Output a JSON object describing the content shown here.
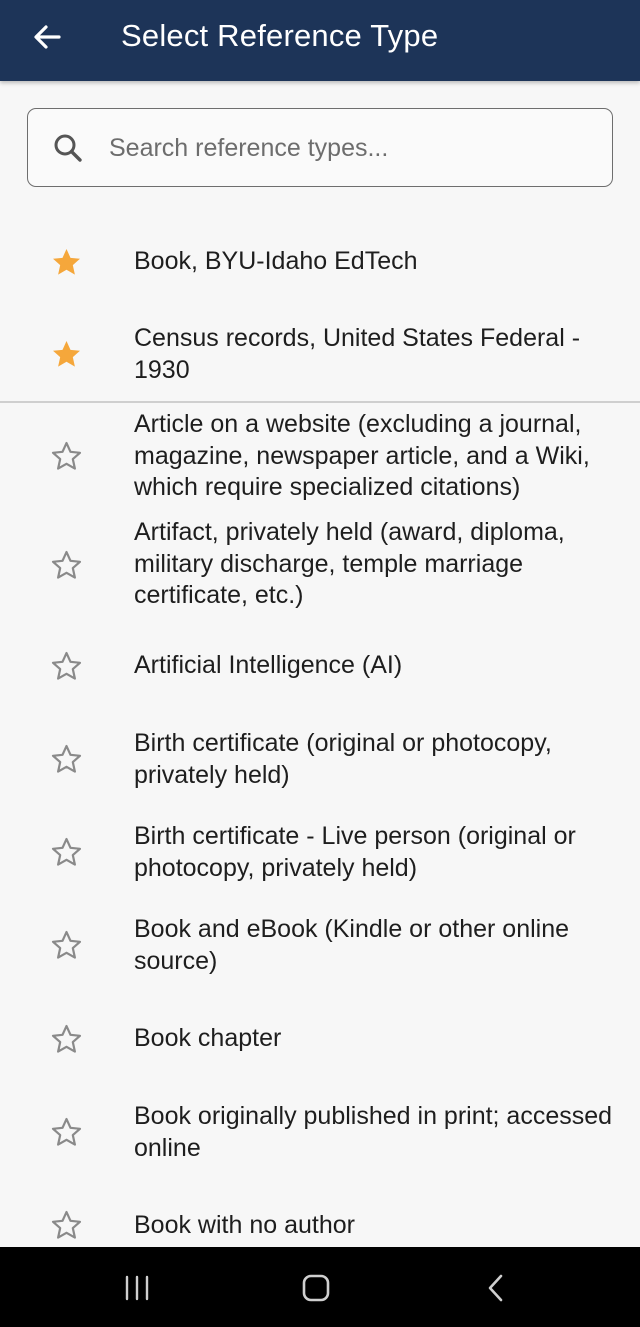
{
  "app_bar": {
    "title": "Select Reference Type",
    "back_icon": "arrow-left-icon"
  },
  "search": {
    "placeholder": "Search reference types...",
    "value": "",
    "icon": "search-icon"
  },
  "colors": {
    "app_bar": "#1d3458",
    "star_filled": "#f5a73b",
    "star_outline": "#8a8a8a",
    "background": "#f7f7f7"
  },
  "favorites": [
    {
      "label": "Book, BYU-Idaho EdTech",
      "favorite": true
    },
    {
      "label": "Census records, United States Federal - 1930",
      "favorite": true
    }
  ],
  "reference_types": [
    {
      "label": "Article on a website (excluding a journal, magazine, newspaper article, and a Wiki, which require specialized citations)",
      "favorite": false
    },
    {
      "label": "Artifact, privately held (award, diploma, military discharge, temple marriage certificate, etc.)",
      "favorite": false
    },
    {
      "label": "Artificial Intelligence (AI)",
      "favorite": false
    },
    {
      "label": "Birth certificate (original or photocopy, privately held)",
      "favorite": false
    },
    {
      "label": "Birth certificate - Live person (original or photocopy, privately held)",
      "favorite": false
    },
    {
      "label": "Book and eBook (Kindle or other online source)",
      "favorite": false
    },
    {
      "label": "Book chapter",
      "favorite": false
    },
    {
      "label": "Book originally published in print; accessed online",
      "favorite": false
    },
    {
      "label": "Book with no author",
      "favorite": false
    }
  ],
  "nav_bar": {
    "recents_icon": "recents-icon",
    "home_icon": "home-icon",
    "back_icon": "back-chevron-icon"
  }
}
